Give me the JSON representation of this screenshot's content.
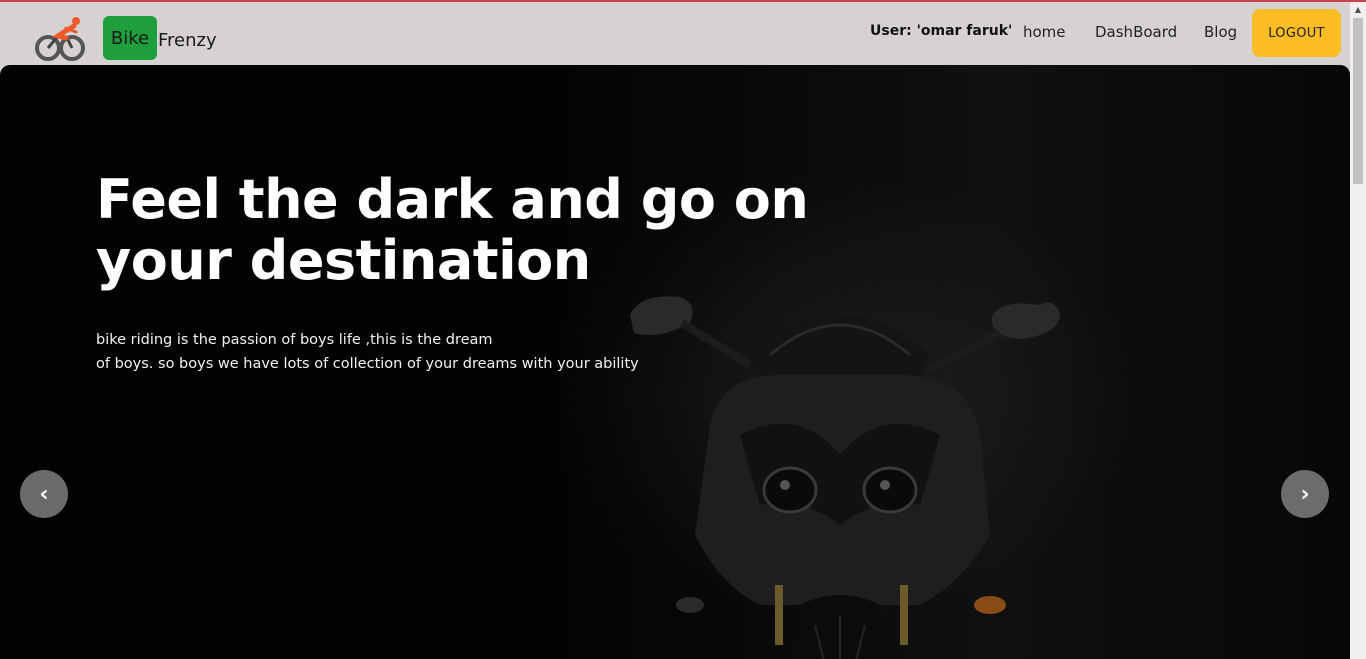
{
  "navbar": {
    "brand_bike": "Bike",
    "brand_frenzy": "Frenzy",
    "user_label": "User: 'omar faruk'",
    "links": [
      {
        "label": "home"
      },
      {
        "label": "DashBoard"
      },
      {
        "label": "Blog"
      }
    ],
    "logout_label": "LOGOUT"
  },
  "hero": {
    "title": "Feel the dark and go on your destination",
    "desc_line1": "bike riding is the passion of boys life ,this is the dream",
    "desc_line2": "of boys. so boys we have lots of collection of your dreams with your ability",
    "prev_label": "‹",
    "next_label": "›"
  },
  "icons": {
    "logo": "cyclist-logo-icon",
    "prev": "chevron-left-icon",
    "next": "chevron-right-icon",
    "scroll_up": "scroll-up-arrow-icon"
  },
  "colors": {
    "accent_red": "#c9434f",
    "brand_green": "#1f9e3e",
    "logout_yellow": "#fbbd23",
    "nav_bg": "#d6d2d2",
    "hero_bg": "#030303"
  }
}
